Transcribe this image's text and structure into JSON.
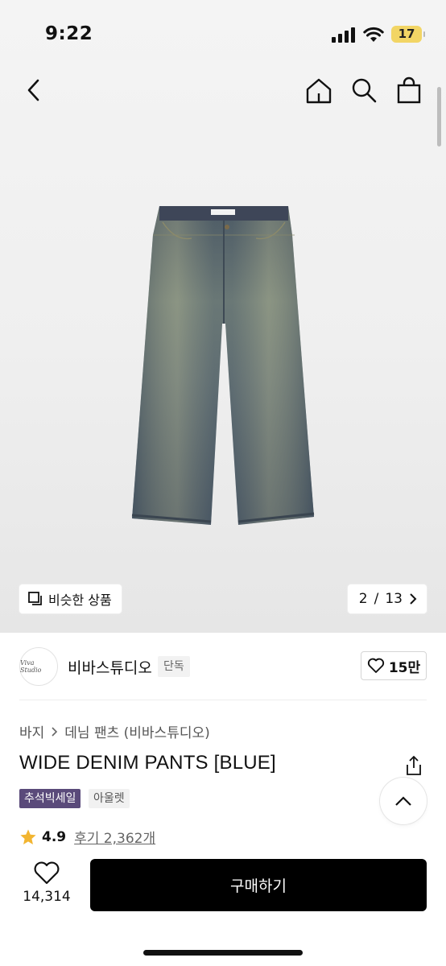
{
  "status_bar": {
    "time": "9:22",
    "battery": "17"
  },
  "gallery": {
    "similar_label": "비슷한 상품",
    "current": "2",
    "separator": "/",
    "total": "13",
    "image_brand_tag": "VivaStudio"
  },
  "brand": {
    "name": "비바스튜디오",
    "badge": "단독",
    "likes": "15만",
    "logo_text": "Viva Studio"
  },
  "breadcrumb": [
    "바지",
    "데님 팬츠 (비바스튜디오)"
  ],
  "product": {
    "title": "WIDE DENIM PANTS [BLUE]",
    "tags": [
      "추석빅세일",
      "아울렛"
    ],
    "rating": "4.9",
    "review_label": "후기 2,362개"
  },
  "bottom_bar": {
    "wish_count": "14,314",
    "buy_label": "구매하기"
  },
  "colors": {
    "sale_tag": "#5a4a7a",
    "star": "#f2b531",
    "buy_button": "#000000",
    "battery": "#f2d565"
  }
}
